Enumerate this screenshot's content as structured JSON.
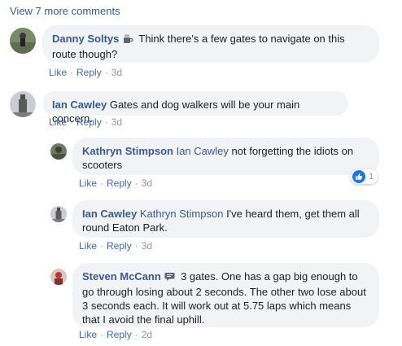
{
  "view_more": "View 7 more comments",
  "comments": [
    {
      "author": "Danny Soltys",
      "badge": "coffee-icon",
      "text": "Think there's a few gates to navigate on this route though?",
      "like": "Like",
      "reply": "Reply",
      "time": "3d"
    },
    {
      "author": "Ian Cawley",
      "text": "Gates and dog walkers will be your main concern.",
      "like": "Like",
      "reply": "Reply",
      "time": "3d"
    }
  ],
  "replies": [
    {
      "author": "Kathryn Stimpson",
      "mention": "Ian Cawley",
      "text": "not forgetting the idiots on scooters",
      "like": "Like",
      "reply": "Reply",
      "time": "3d",
      "reaction_count": "1"
    },
    {
      "author": "Ian Cawley",
      "mention": "Kathryn Stimpson",
      "text": "I've heard them, get them all round Eaton Park.",
      "like": "Like",
      "reply": "Reply",
      "time": "3d"
    },
    {
      "author": "Steven McCann",
      "badge": "speech-bubble-icon",
      "text": "3 gates. One has a gap big enough to go through losing about 2 seconds. The other two lose about 3 seconds each. It will work out at 5.75 laps which means that I avoid the final uphill.",
      "like": "Like",
      "reply": "Reply",
      "time": "2d"
    }
  ],
  "colors": {
    "link": "#385898",
    "action": "#4267b2",
    "bubble": "#f2f3f5",
    "like_blue": "#1877f2"
  }
}
